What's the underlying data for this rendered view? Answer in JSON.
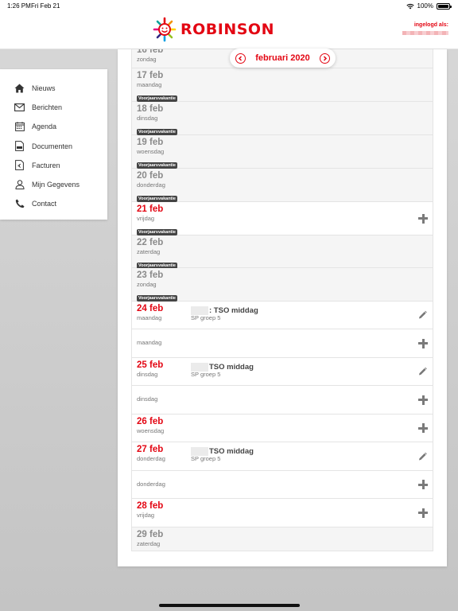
{
  "status_bar": {
    "time": "1:26 PM",
    "date": "Fri Feb 21",
    "battery": "100%",
    "icons": [
      "wifi-icon",
      "battery-icon"
    ]
  },
  "header": {
    "logo_text": "ROBINSON",
    "login_label": "ingelogd als:"
  },
  "colors": {
    "brand": "#e30613",
    "badge": "#444444",
    "past_row": "#f5f5f5"
  },
  "month_nav": {
    "label": "februari 2020",
    "prev_icon": "chevron-left-icon",
    "next_icon": "chevron-right-icon"
  },
  "sidebar": {
    "items": [
      {
        "label": "Nieuws",
        "icon": "home-icon"
      },
      {
        "label": "Berichten",
        "icon": "mail-icon"
      },
      {
        "label": "Agenda",
        "icon": "calendar-icon"
      },
      {
        "label": "Documenten",
        "icon": "document-icon"
      },
      {
        "label": "Facturen",
        "icon": "invoice-icon"
      },
      {
        "label": "Mijn Gegevens",
        "icon": "user-icon"
      },
      {
        "label": "Contact",
        "icon": "phone-icon"
      }
    ]
  },
  "days": [
    {
      "date": "16 feb",
      "weekday": "zondag"
    },
    {
      "date": "17 feb",
      "weekday": "maandag",
      "badge": "Voorjaarsvakantie"
    },
    {
      "date": "18 feb",
      "weekday": "dinsdag",
      "badge": "Voorjaarsvakantie"
    },
    {
      "date": "19 feb",
      "weekday": "woensdag",
      "badge": "Voorjaarsvakantie"
    },
    {
      "date": "20 feb",
      "weekday": "donderdag",
      "badge": "Voorjaarsvakantie"
    },
    {
      "date": "21 feb",
      "weekday": "vrijdag",
      "badge": "Voorjaarsvakantie"
    },
    {
      "date": "22 feb",
      "weekday": "zaterdag",
      "badge": "Voorjaarsvakantie"
    },
    {
      "date": "23 feb",
      "weekday": "zondag",
      "badge": "Voorjaarsvakantie"
    },
    {
      "date": "24 feb",
      "weekday": "maandag",
      "event_title": ": TSO middag",
      "event_sub": "SP groep 5"
    },
    {
      "weekday": "maandag"
    },
    {
      "date": "25 feb",
      "weekday": "dinsdag",
      "event_title": "TSO middag",
      "event_sub": "SP groep 5"
    },
    {
      "weekday": "dinsdag"
    },
    {
      "date": "26 feb",
      "weekday": "woensdag"
    },
    {
      "date": "27 feb",
      "weekday": "donderdag",
      "event_title": "TSO middag",
      "event_sub": "SP groep 5"
    },
    {
      "weekday": "donderdag"
    },
    {
      "date": "28 feb",
      "weekday": "vrijdag"
    },
    {
      "date": "29 feb",
      "weekday": "zaterdag"
    }
  ]
}
